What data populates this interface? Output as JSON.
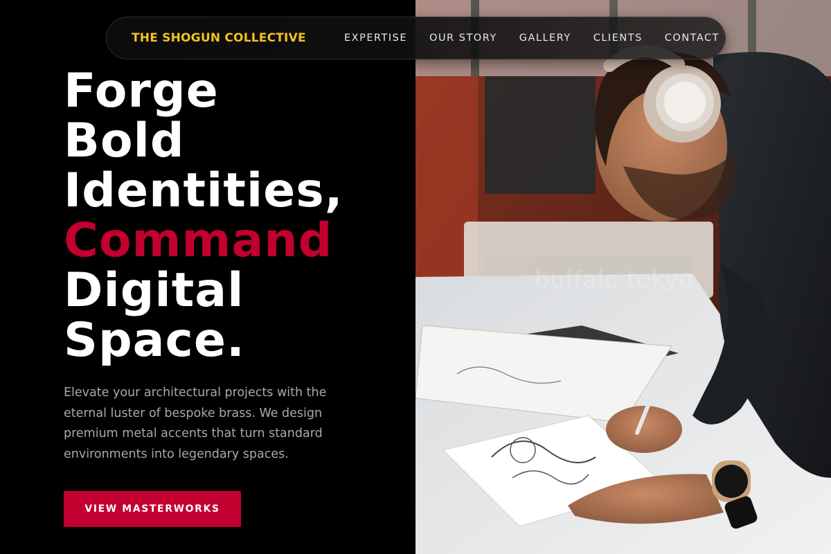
{
  "brand": {
    "name": "THE SHOGUN COLLECTIVE"
  },
  "nav": {
    "links": [
      "EXPERTISE",
      "OUR STORY",
      "GALLERY",
      "CLIENTS",
      "CONTACT"
    ]
  },
  "hero": {
    "headline": {
      "line1": "Forge",
      "line2": "Bold",
      "line3": "Identities,",
      "accent": "Command",
      "line5": "Digital",
      "line6": "Space."
    },
    "lead": "Elevate your architectural projects with the eternal luster of bespoke brass. We design premium metal accents that turn standard environments into legendary spaces.",
    "cta_label": "VIEW MASTERWORKS",
    "photo_watermark": "buffalo tokyo"
  },
  "colors": {
    "background": "#000000",
    "brand": "#f4c31a",
    "accent": "#c2002f",
    "nav_text": "#e8e8e8",
    "lead_text": "#a5a9b2"
  }
}
